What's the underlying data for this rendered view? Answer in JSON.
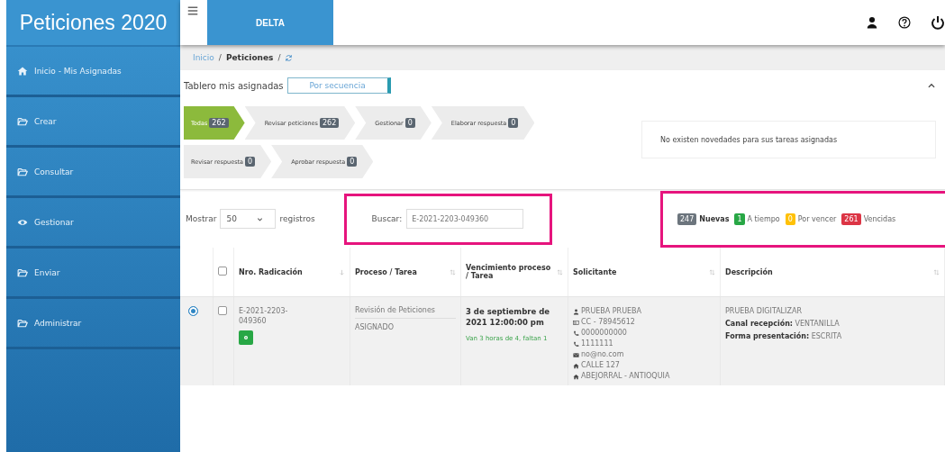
{
  "app_title": "Peticiones 2020",
  "top_tabs": [
    {
      "label": "DELTA",
      "selected": true
    }
  ],
  "sidebar": {
    "items": [
      {
        "label": "Inicio - Mis Asignadas",
        "kind": "home"
      },
      {
        "label": "Crear",
        "kind": "folder"
      },
      {
        "label": "Consultar",
        "kind": "folder"
      },
      {
        "label": "Gestionar",
        "kind": "eye"
      },
      {
        "label": "Enviar",
        "kind": "folder"
      },
      {
        "label": "Administrar",
        "kind": "folder"
      }
    ]
  },
  "breadcrumb": [
    {
      "label": "Inicio",
      "kind": "link",
      "separator": "/"
    },
    {
      "label": "Peticiones",
      "kind": "current",
      "separator": "/"
    }
  ],
  "board": {
    "label": "Tablero mis asignadas",
    "select": "Por secuencia"
  },
  "steps": [
    [
      {
        "label": "Todas",
        "count": "262",
        "selected": true
      },
      {
        "label": "Revisar peticiones",
        "count": "262",
        "selected": false
      },
      {
        "label": "Gestionar",
        "count": "0",
        "selected": false
      },
      {
        "label": "Elaborar respuesta",
        "count": "0",
        "selected": false
      }
    ],
    [
      {
        "label": "Revisar respuesta",
        "count": "0",
        "selected": false
      },
      {
        "label": "Aprobar respuesta",
        "count": "0",
        "selected": false
      }
    ]
  ],
  "notice": "No existen novedades para sus tareas asignadas",
  "length": {
    "before": "Mostrar",
    "value": "50",
    "after": "registros"
  },
  "search": {
    "label": "Buscar:",
    "value": "E-2021-2203-049360"
  },
  "legend": [
    {
      "count": "247",
      "label": "Nuevas",
      "color": "#6c757d",
      "bold": true
    },
    {
      "count": "1",
      "label": "A tiempo",
      "color": "#28a745",
      "bold": false
    },
    {
      "count": "0",
      "label": "Por vencer",
      "color": "#ffc107",
      "bold": false
    },
    {
      "count": "261",
      "label": "Vencidas",
      "color": "#dc3545",
      "bold": false
    }
  ],
  "table": {
    "header_checked": false,
    "columns": [
      "Nro. Radicación",
      "Proceso / Tarea",
      "Vencimiento proceso / Tarea",
      "Solicitante",
      "Descripción"
    ],
    "rows": [
      {
        "selected": true,
        "checked": false,
        "number": "E-2021-2203-049360",
        "process": "Revisión de Peticiones",
        "task": "ASIGNADO",
        "due": "3 de septiembre de 2021 12:00:00 pm",
        "due_note": "Van 3 horas de 4, faltan 1",
        "requester": [
          {
            "kind": "user",
            "text": "PRUEBA PRUEBA"
          },
          {
            "kind": "id-card",
            "text": "CC - 78945612"
          },
          {
            "kind": "phone",
            "text": "0000000000"
          },
          {
            "kind": "phone",
            "text": "1111111"
          },
          {
            "kind": "envelope",
            "text": "no@no.com"
          },
          {
            "kind": "home",
            "text": "CALLE 127"
          },
          {
            "kind": "home",
            "text": "ABEJORRAL - ANTIOQUIA"
          }
        ],
        "description": [
          "PRUEBA DIGITALIZAR",
          "**Canal recepción:** VENTANILLA",
          "**Forma presentación:** ESCRITA"
        ]
      }
    ]
  }
}
